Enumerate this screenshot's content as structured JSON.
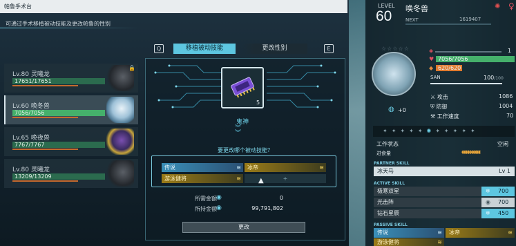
{
  "window": {
    "title": "帕鲁手术台",
    "subtitle": "可通过手术移植被动技能及更改帕鲁的性别"
  },
  "pal_list": [
    {
      "level": "Lv.80",
      "name": "灵曦龙",
      "hp": "17651/17651",
      "hp_fraction": 1.0,
      "locked": true
    },
    {
      "level": "Lv.60",
      "name": "唤冬兽",
      "hp": "7056/7056",
      "hp_fraction": 1.0,
      "selected": true
    },
    {
      "level": "Lv.65",
      "name": "唤夜兽",
      "hp": "7767/7767",
      "hp_fraction": 1.0
    },
    {
      "level": "Lv.80",
      "name": "灵曦龙",
      "hp": "13209/13209",
      "hp_fraction": 1.0
    }
  ],
  "tabs": {
    "left_key": "Q",
    "right_key": "E",
    "active": "移植被动技能",
    "inactive": "更改性别"
  },
  "item": {
    "name": "鬼神",
    "count": "5"
  },
  "question": "要更改哪个被动技能？",
  "skills": [
    {
      "name": "传说",
      "style": "blue"
    },
    {
      "name": "冰帝",
      "style": "gold"
    },
    {
      "name": "游泳健将",
      "style": "gold"
    },
    {
      "name": "+",
      "style": "empty"
    }
  ],
  "cost": {
    "required_label": "所需金额",
    "required_value": "0",
    "owned_label": "所持金额",
    "owned_value": "99,791,802"
  },
  "change_button": "更改",
  "detail": {
    "level_label": "LEVEL",
    "level": "60",
    "name": "唤冬兽",
    "next_label": "NEXT",
    "next_value": "1619407",
    "rank_bonus": "+0",
    "slot_count": "1",
    "hp": "7056",
    "hp_max": "/7056",
    "sp": "620",
    "sp_max": "/620",
    "san_label": "SAN",
    "san": "100",
    "san_max": "/100",
    "stats": [
      {
        "label": "攻击",
        "value": "1086"
      },
      {
        "label": "防御",
        "value": "1004"
      },
      {
        "label": "工作速度",
        "value": "70"
      }
    ],
    "work_state_label": "工作状态",
    "work_state_value": "空闲",
    "food_label": "进食量",
    "partner_skill_header": "PARTNER SKILL",
    "partner_skill": {
      "name": "冰天马",
      "level": "Lv 1"
    },
    "active_skill_header": "ACTIVE SKILL",
    "active_skills": [
      {
        "name": "极寒双星",
        "power": "700",
        "element": "ice"
      },
      {
        "name": "光击阵",
        "power": "700",
        "element": "neutral"
      },
      {
        "name": "钻石星辰",
        "power": "450",
        "element": "ice"
      }
    ],
    "passive_skill_header": "PASSIVE SKILL",
    "passive_skills": [
      {
        "name": "传说",
        "style": "blue"
      },
      {
        "name": "冰帝",
        "style": "gold"
      },
      {
        "name": "游泳健将",
        "style": "gold"
      }
    ]
  },
  "colors": {
    "accent": "#5dc6e0",
    "hp_green": "#45b06b",
    "sp_orange": "#e07a2e",
    "gold": "#c8a02a"
  }
}
